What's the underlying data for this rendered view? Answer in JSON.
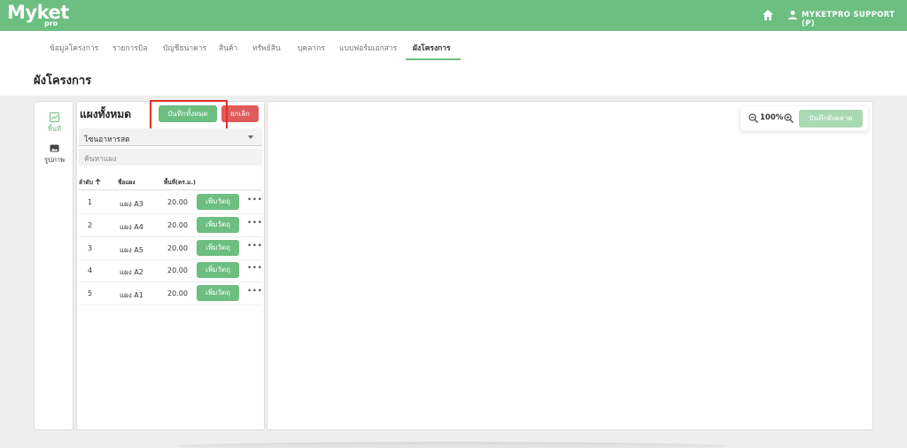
{
  "header": {
    "logo_main": "Myket",
    "logo_sub": "pro",
    "user_name": "MYKETPRO SUPPORT (P)"
  },
  "tabs": [
    {
      "label": "ข้อมูลโครงการ"
    },
    {
      "label": "รายการบิล"
    },
    {
      "label": "บัญชีธนาคาร"
    },
    {
      "label": "สินค้า"
    },
    {
      "label": "ทรัพย์สิน"
    },
    {
      "label": "บุคลากร"
    },
    {
      "label": "แบบฟอร์มเอกสาร"
    },
    {
      "label": "ผังโครงการ",
      "active": true
    }
  ],
  "page": {
    "title": "ผังโครงการ"
  },
  "sidebar": {
    "items": [
      {
        "label": "พื้นที่",
        "icon": "area-icon",
        "active": true
      },
      {
        "label": "รูปภาพ",
        "icon": "image-icon",
        "active": false
      }
    ]
  },
  "panel": {
    "title": "แผงทั้งหมด",
    "save_all_label": "บันทึกทั้งหมด",
    "cancel_label": "ยกเลิก",
    "zone_select_value": "โซนอาหารสด",
    "search_placeholder": "ค้นหาแผง",
    "columns": [
      "ลำดับ",
      "ชื่อแผง",
      "พื้นที่(ตร.ม.)"
    ],
    "sort_icon": "arrow-up-icon",
    "rows": [
      {
        "index": "1",
        "name": "แผง A3",
        "area": "20.00",
        "action": "เพิ่มวัตถุ"
      },
      {
        "index": "2",
        "name": "แผง A4",
        "area": "20.00",
        "action": "เพิ่มวัตถุ"
      },
      {
        "index": "3",
        "name": "แผง A5",
        "area": "20.00",
        "action": "เพิ่มวัตถุ"
      },
      {
        "index": "4",
        "name": "แผง A2",
        "area": "20.00",
        "action": "เพิ่มวัตถุ"
      },
      {
        "index": "5",
        "name": "แผง A1",
        "area": "20.00",
        "action": "เพิ่มวัตถุ"
      }
    ]
  },
  "canvas": {
    "zoom_level": "100%",
    "save_layout_label": "บันทึกผังตลาด"
  },
  "colors": {
    "brand_green": "#6cbe81",
    "danger_red": "#e05b5b",
    "highlight_red": "#e0302a"
  }
}
